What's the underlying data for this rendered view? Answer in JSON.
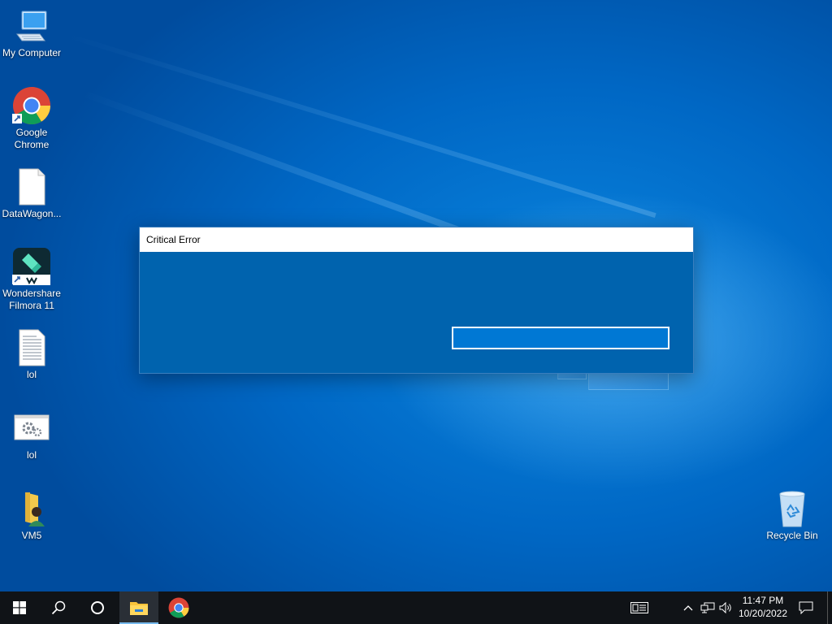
{
  "desktop": {
    "icons": [
      {
        "label": "My Computer",
        "icon": "computer-icon"
      },
      {
        "label": "Google Chrome",
        "icon": "chrome-icon"
      },
      {
        "label": "DataWagon...",
        "icon": "blank-file-icon"
      },
      {
        "label": "Wondershare Filmora 11",
        "icon": "filmora-icon"
      },
      {
        "label": "lol",
        "icon": "text-file-icon"
      },
      {
        "label": "lol",
        "icon": "settings-file-icon"
      },
      {
        "label": "VM5",
        "icon": "user-folder-icon"
      },
      {
        "label": "Recycle Bin",
        "icon": "recycle-bin-icon"
      }
    ]
  },
  "dialog": {
    "title": "Critical Error",
    "button_label": ""
  },
  "taskbar": {
    "buttons": [
      "start-icon",
      "search-icon",
      "cortana-icon",
      "file-explorer-icon",
      "chrome-icon"
    ],
    "tray": [
      "news-icon",
      "chevron-up-icon",
      "network-icon",
      "volume-icon",
      "notification-icon"
    ],
    "time": "11:47 PM",
    "date": "10/20/2022"
  },
  "colors": {
    "dialog_body": "#0063ae",
    "taskbar": "#101317",
    "desktop": "#0078d7"
  }
}
